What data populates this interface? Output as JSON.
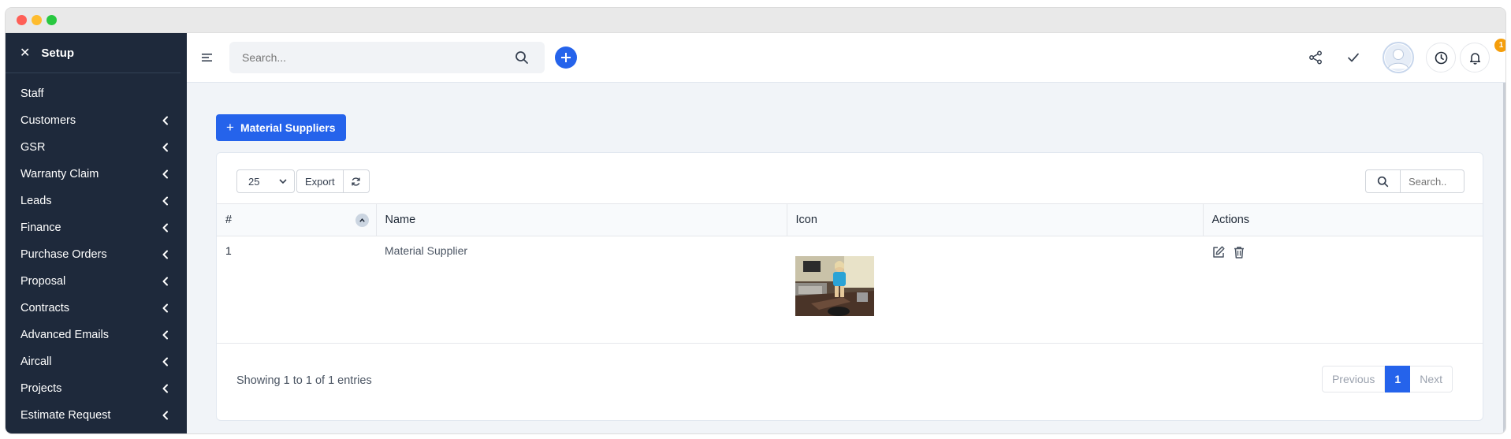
{
  "sidebar": {
    "title": "Setup",
    "items": [
      {
        "label": "Staff",
        "has_children": false
      },
      {
        "label": "Customers",
        "has_children": true
      },
      {
        "label": "GSR",
        "has_children": true
      },
      {
        "label": "Warranty Claim",
        "has_children": true
      },
      {
        "label": "Leads",
        "has_children": true
      },
      {
        "label": "Finance",
        "has_children": true
      },
      {
        "label": "Purchase Orders",
        "has_children": true
      },
      {
        "label": "Proposal",
        "has_children": true
      },
      {
        "label": "Contracts",
        "has_children": true
      },
      {
        "label": "Advanced Emails",
        "has_children": true
      },
      {
        "label": "Aircall",
        "has_children": true
      },
      {
        "label": "Projects",
        "has_children": true
      },
      {
        "label": "Estimate Request",
        "has_children": true
      }
    ]
  },
  "topbar": {
    "search_placeholder": "Search...",
    "notification_count": "1"
  },
  "page": {
    "add_button_label": "Material Suppliers"
  },
  "table": {
    "page_length": "25",
    "export_label": "Export",
    "search_placeholder": "Search..",
    "columns": [
      "#",
      "Name",
      "Icon",
      "Actions"
    ],
    "rows": [
      {
        "num": "1",
        "name": "Material Supplier",
        "icon": "supplier-photo"
      }
    ],
    "info": "Showing 1 to 1 of 1 entries",
    "pagination": {
      "previous": "Previous",
      "current": "1",
      "next": "Next"
    }
  },
  "colors": {
    "sidebar_bg": "#1e293b",
    "primary": "#2563eb",
    "badge": "#f59e0b"
  }
}
